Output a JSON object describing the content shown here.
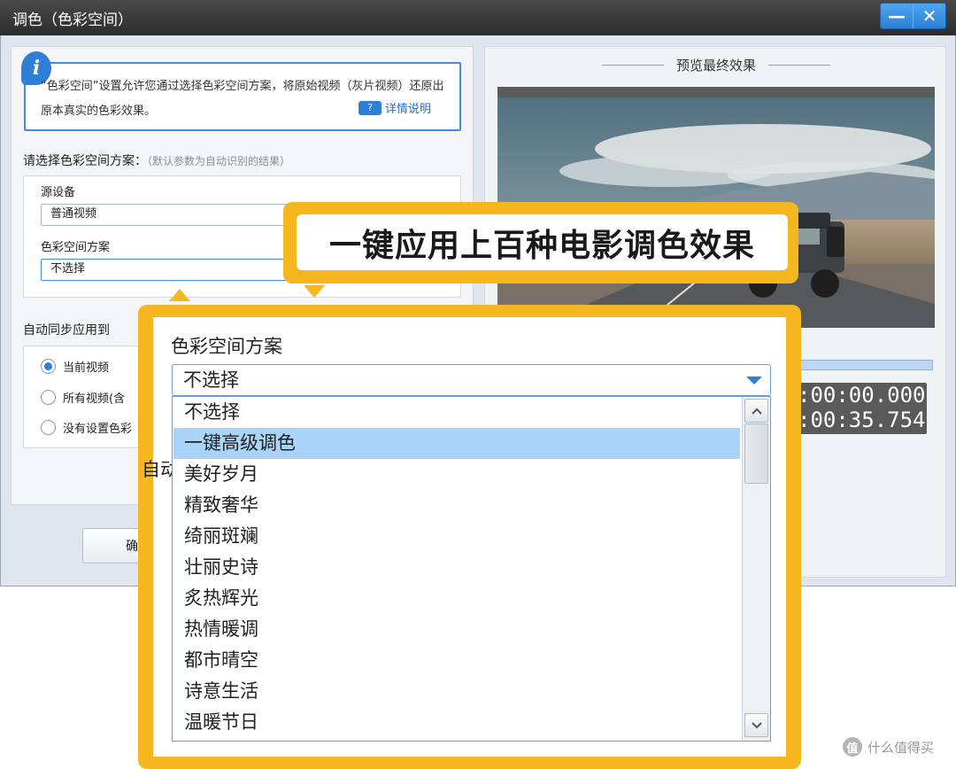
{
  "window": {
    "title": "调色（色彩空间）",
    "minimize_glyph": "—",
    "close_glyph": "✕"
  },
  "info": {
    "text": "“色彩空间”设置允许您通过选择色彩空间方案，将原始视频（灰片视频）还原出原本真实的色彩效果。",
    "detail_link": "详情说明",
    "detail_icon": "?"
  },
  "scheme": {
    "heading": "请选择色彩空间方案：",
    "hint": "（默认参数为自动识别的结果）",
    "source_label": "源设备",
    "source_value": "普通视频",
    "color_label": "色彩空间方案",
    "color_value": "不选择"
  },
  "sync": {
    "heading": "自动同步应用到",
    "options": [
      "当前视频",
      "所有视频(含",
      "没有设置色彩"
    ],
    "selected_index": 0
  },
  "buttons": {
    "confirm_partial": "确"
  },
  "preview": {
    "title": "预览最终效果",
    "time_current": ":00:00.000",
    "time_total": ":00:35.754"
  },
  "callout": {
    "text": "一键应用上百种电影调色效果"
  },
  "zoom": {
    "heading": "色彩空间方案",
    "select_value": "不选择",
    "behind_partial": "自动",
    "items": [
      "不选择",
      "一键高级调色",
      "美好岁月",
      "精致奢华",
      "绮丽斑斓",
      "壮丽史诗",
      "炙热辉光",
      "热情暖调",
      "都市晴空",
      "诗意生活",
      "温暖节日"
    ],
    "highlighted_index": 1
  },
  "watermark": {
    "text": "什么值得买",
    "icon": "值"
  }
}
